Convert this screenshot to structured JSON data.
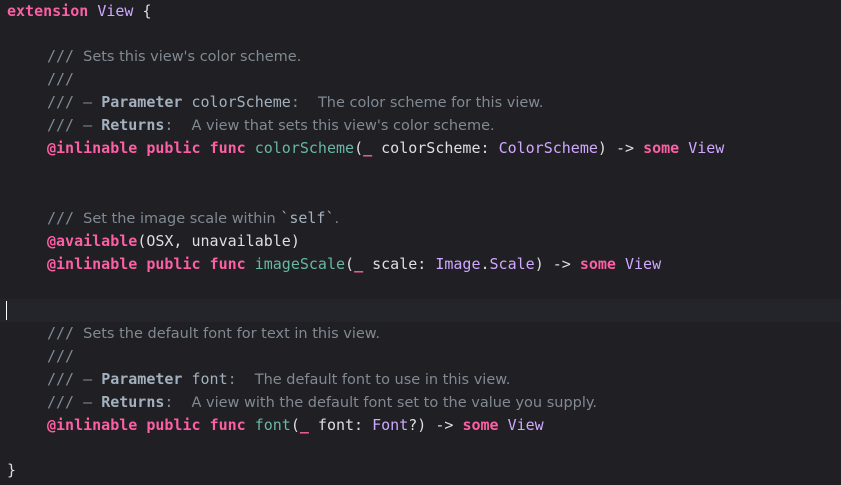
{
  "colors": {
    "background": "#1f1f24",
    "current_line": "#23252b",
    "keyword": "#fc5fa3",
    "type": "#d0a8ff",
    "function": "#67b7a4",
    "comment": "#7f8c98",
    "plain": "#dfdfe0"
  },
  "code": {
    "extension_kw": "extension",
    "extension_type": "View",
    "open_brace": " {",
    "close_brace": "}",
    "doc_prefix": "///",
    "doc_dash": " – ",
    "block1": {
      "summary": "Sets this view's color scheme.",
      "param_label": "Parameter",
      "param_name": "colorScheme",
      "param_colon": ":",
      "param_desc": "The color scheme for this view.",
      "returns_label": "Returns",
      "returns_colon": ":",
      "returns_desc": "A view that sets this view's color scheme.",
      "attr": "@inlinable",
      "access": "public",
      "func_kw": "func",
      "name": "colorScheme",
      "paren_open": "(",
      "underscore": "_",
      "arg_label": " colorScheme: ",
      "arg_type": "ColorScheme",
      "paren_close": ")",
      "arrow": " -> ",
      "some_kw": "some",
      "ret_type": "View"
    },
    "block2": {
      "summary_pre": "Set the image scale within ",
      "summary_code": "`self`",
      "summary_post": ".",
      "available_attr": "@available",
      "available_args": "(OSX, unavailable)",
      "attr": "@inlinable",
      "access": "public",
      "func_kw": "func",
      "name": "imageScale",
      "paren_open": "(",
      "underscore": "_",
      "arg_label": " scale: ",
      "arg_type_a": "Image",
      "arg_dot": ".",
      "arg_type_b": "Scale",
      "paren_close": ")",
      "arrow": " -> ",
      "some_kw": "some",
      "ret_type": "View"
    },
    "block3": {
      "summary": "Sets the default font for text in this view.",
      "param_label": "Parameter",
      "param_name": "font",
      "param_colon": ":",
      "param_desc": "The default font to use in this view.",
      "returns_label": "Returns",
      "returns_colon": ":",
      "returns_desc": "A view with the default font set to the value you supply.",
      "attr": "@inlinable",
      "access": "public",
      "func_kw": "func",
      "name": "font",
      "paren_open": "(",
      "underscore": "_",
      "arg_label": " font: ",
      "arg_type": "Font",
      "optional": "?",
      "paren_close": ")",
      "arrow": " -> ",
      "some_kw": "some",
      "ret_type": "View"
    }
  }
}
